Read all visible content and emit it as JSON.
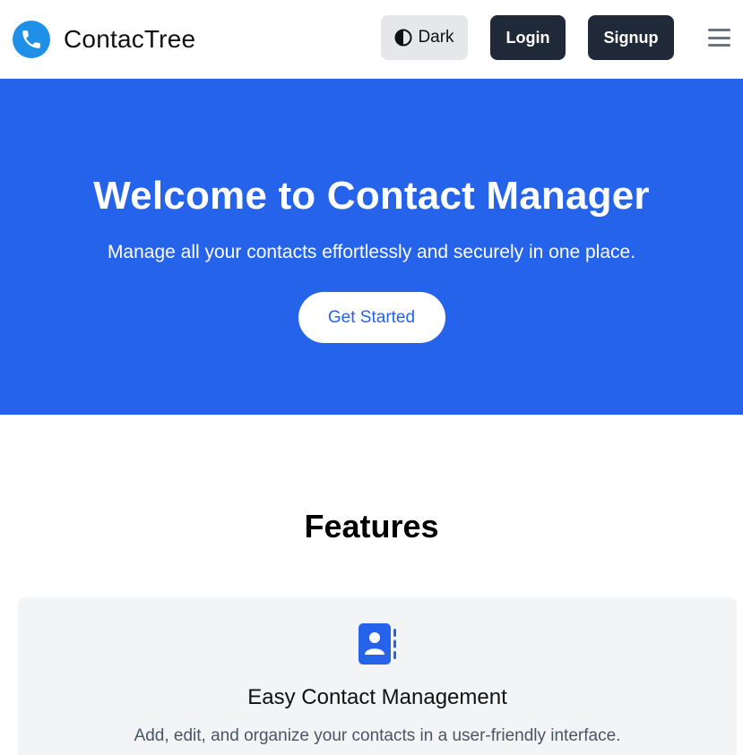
{
  "brand": {
    "name": "ContacTree",
    "icon": "phone-icon",
    "icon_color": "#1e90e8"
  },
  "nav": {
    "theme_toggle": {
      "label": "Dark",
      "icon": "contrast-icon"
    },
    "login_label": "Login",
    "signup_label": "Signup",
    "menu_icon": "hamburger-menu-icon"
  },
  "hero": {
    "title": "Welcome to Contact Manager",
    "subtitle": "Manage all your contacts effortlessly and securely in one place.",
    "cta_label": "Get Started",
    "background": "#2563eb"
  },
  "features": {
    "heading": "Features",
    "items": [
      {
        "icon": "address-book-icon",
        "title": "Easy Contact Management",
        "description": "Add, edit, and organize your contacts in a user-friendly interface."
      }
    ]
  }
}
